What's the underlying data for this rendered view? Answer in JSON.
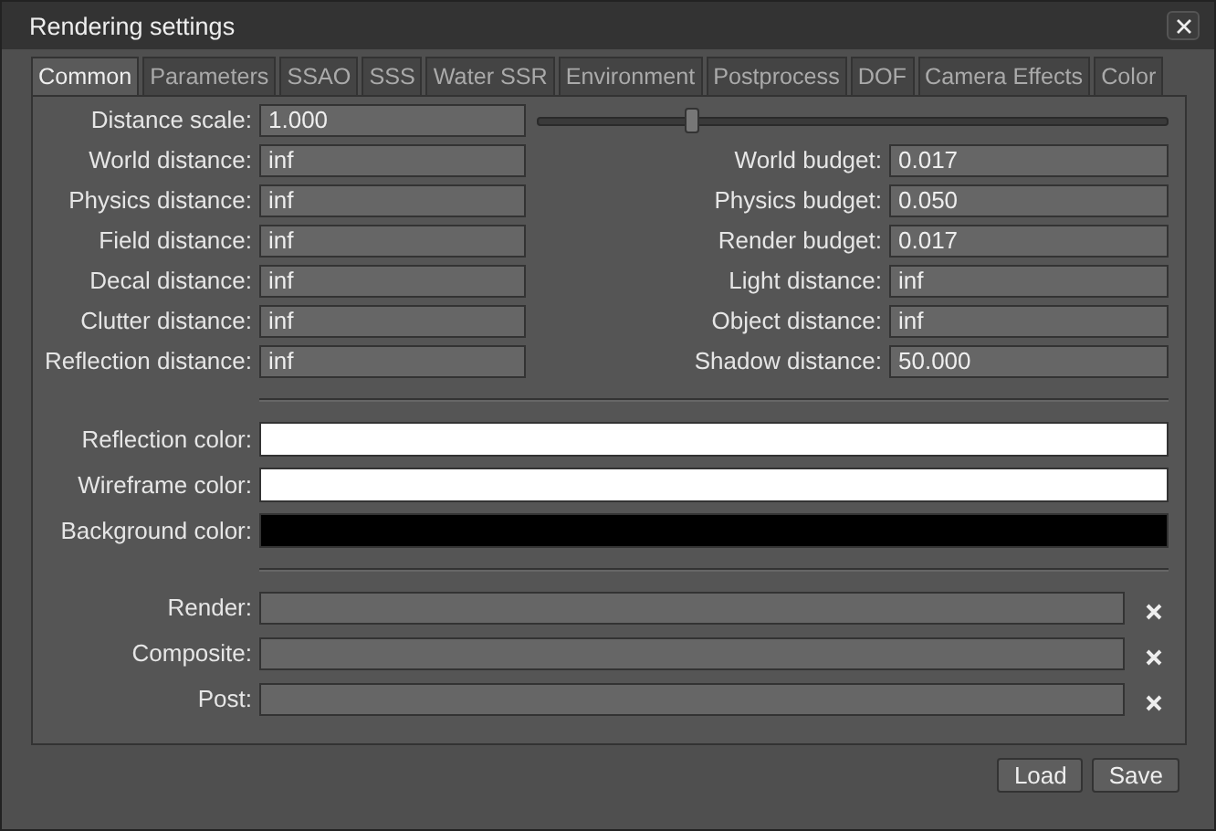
{
  "window": {
    "title": "Rendering settings"
  },
  "tabs": [
    {
      "label": "Common",
      "selected": true
    },
    {
      "label": "Parameters",
      "selected": false
    },
    {
      "label": "SSAO",
      "selected": false
    },
    {
      "label": "SSS",
      "selected": false
    },
    {
      "label": "Water SSR",
      "selected": false
    },
    {
      "label": "Environment",
      "selected": false
    },
    {
      "label": "Postprocess",
      "selected": false
    },
    {
      "label": "DOF",
      "selected": false
    },
    {
      "label": "Camera Effects",
      "selected": false
    },
    {
      "label": "Color",
      "selected": false
    }
  ],
  "distance_scale": {
    "label": "Distance scale:",
    "value": "1.000",
    "level": 0.25
  },
  "left_fields": [
    {
      "label": "World distance:",
      "value": "inf"
    },
    {
      "label": "Physics distance:",
      "value": "inf"
    },
    {
      "label": "Field distance:",
      "value": "inf"
    },
    {
      "label": "Decal distance:",
      "value": "inf"
    },
    {
      "label": "Clutter distance:",
      "value": "inf"
    },
    {
      "label": "Reflection distance:",
      "value": "inf"
    }
  ],
  "right_fields": [
    {
      "label": "World budget:",
      "value": "0.017"
    },
    {
      "label": "Physics budget:",
      "value": "0.050"
    },
    {
      "label": "Render budget:",
      "value": "0.017"
    },
    {
      "label": "Light distance:",
      "value": "inf"
    },
    {
      "label": "Object distance:",
      "value": "inf"
    },
    {
      "label": "Shadow distance:",
      "value": "50.000"
    }
  ],
  "colors": [
    {
      "label": "Reflection color:",
      "color": "#ffffff"
    },
    {
      "label": "Wireframe color:",
      "color": "#ffffff"
    },
    {
      "label": "Background color:",
      "color": "#000000"
    }
  ],
  "paths": [
    {
      "label": "Render:"
    },
    {
      "label": "Composite:"
    },
    {
      "label": "Post:"
    }
  ],
  "buttons": [
    "Load",
    "Save"
  ]
}
